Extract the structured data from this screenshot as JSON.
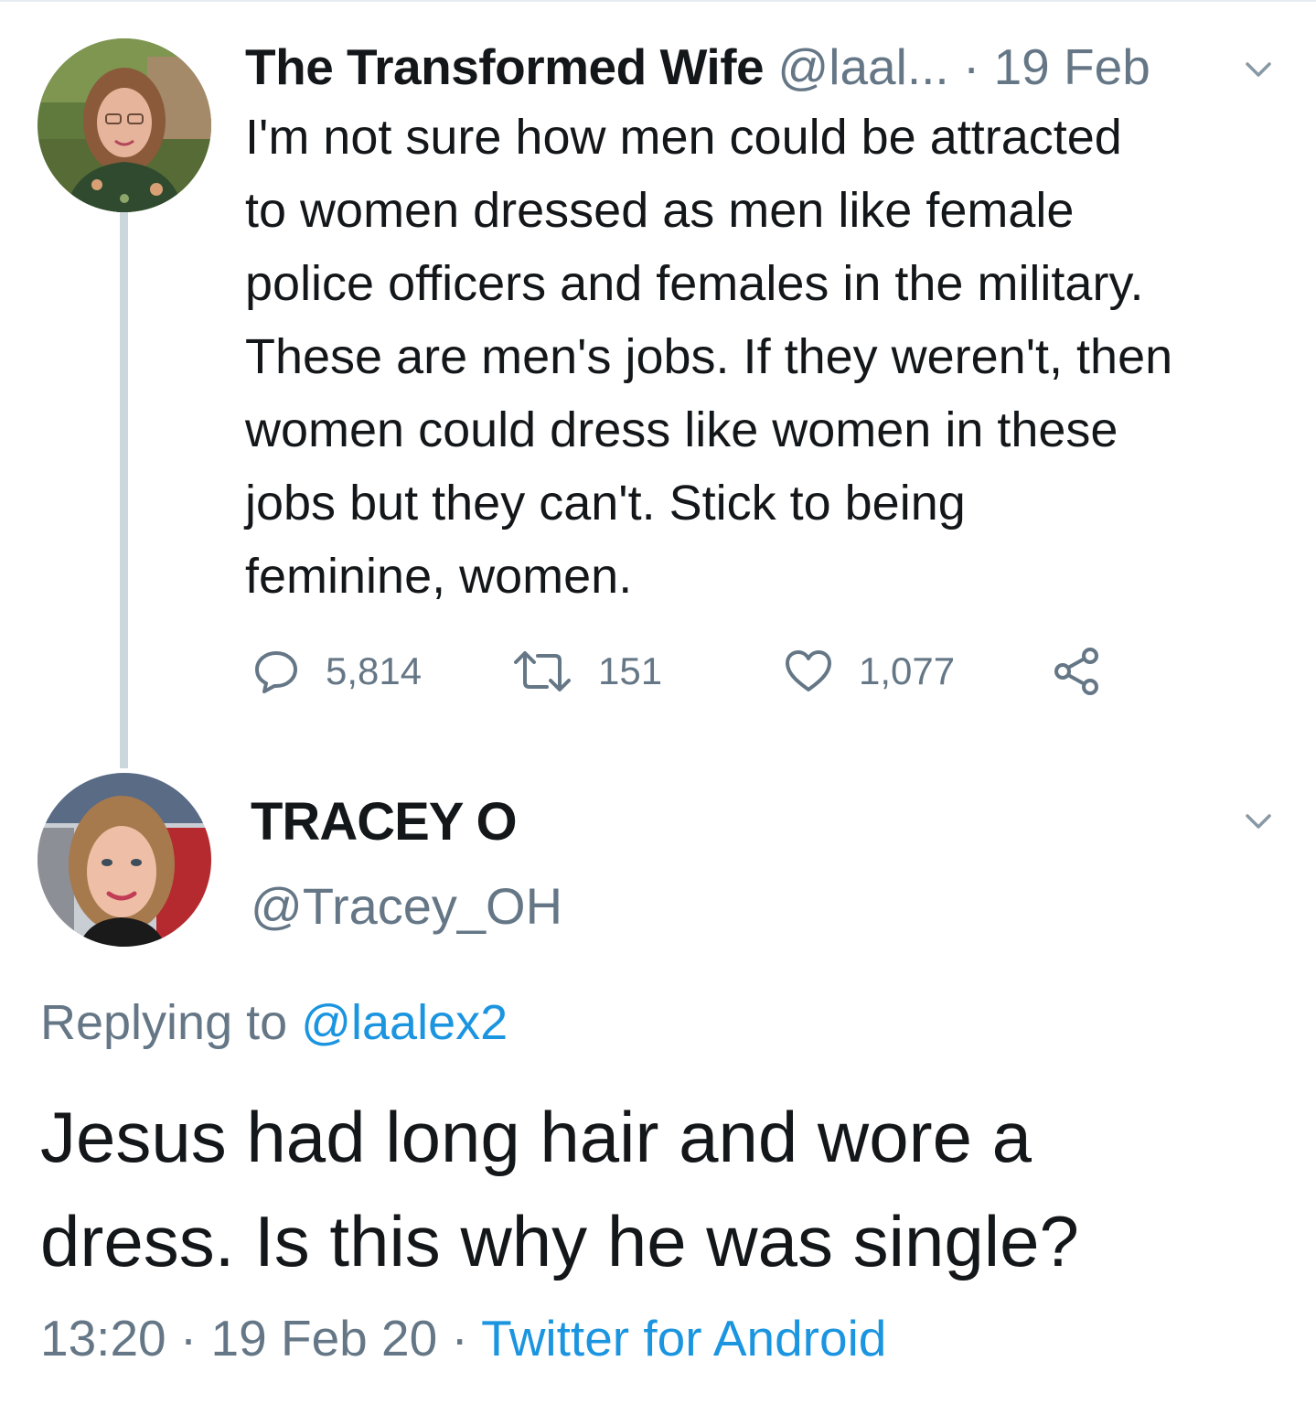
{
  "tweet": {
    "author_name": "The Transformed Wife",
    "author_handle": "@laal...",
    "separator": "·",
    "date": "19 Feb",
    "text_lines": [
      "I'm not sure how men could be attracted",
      "to women dressed as men like female",
      "police officers and females in the military.",
      "These are men's jobs. If they weren't, then",
      "women could dress like women in these",
      "jobs but they can't. Stick to being",
      "feminine, women."
    ],
    "actions": {
      "reply_count": "5,814",
      "retweet_count": "151",
      "like_count": "1,077"
    }
  },
  "reply": {
    "author_name": "TRACEY O",
    "author_handle": "@Tracey_OH",
    "replying_prefix": "Replying to",
    "replying_to": "@laalex2",
    "text_lines": [
      "Jesus had long hair and wore a",
      "dress. Is this why he was single?"
    ],
    "time": "13:20",
    "separator1": "·",
    "date": "19 Feb 20",
    "separator2": "·",
    "source": "Twitter for Android"
  },
  "icons": {
    "reply": "comment-bubble-icon",
    "retweet": "retweet-icon",
    "like": "heart-icon",
    "share": "share-icon",
    "menu": "chevron-down-icon"
  },
  "colors": {
    "text": "#14171a",
    "muted": "#657786",
    "link": "#1b95e0",
    "thread_line": "#ccd6dd"
  }
}
